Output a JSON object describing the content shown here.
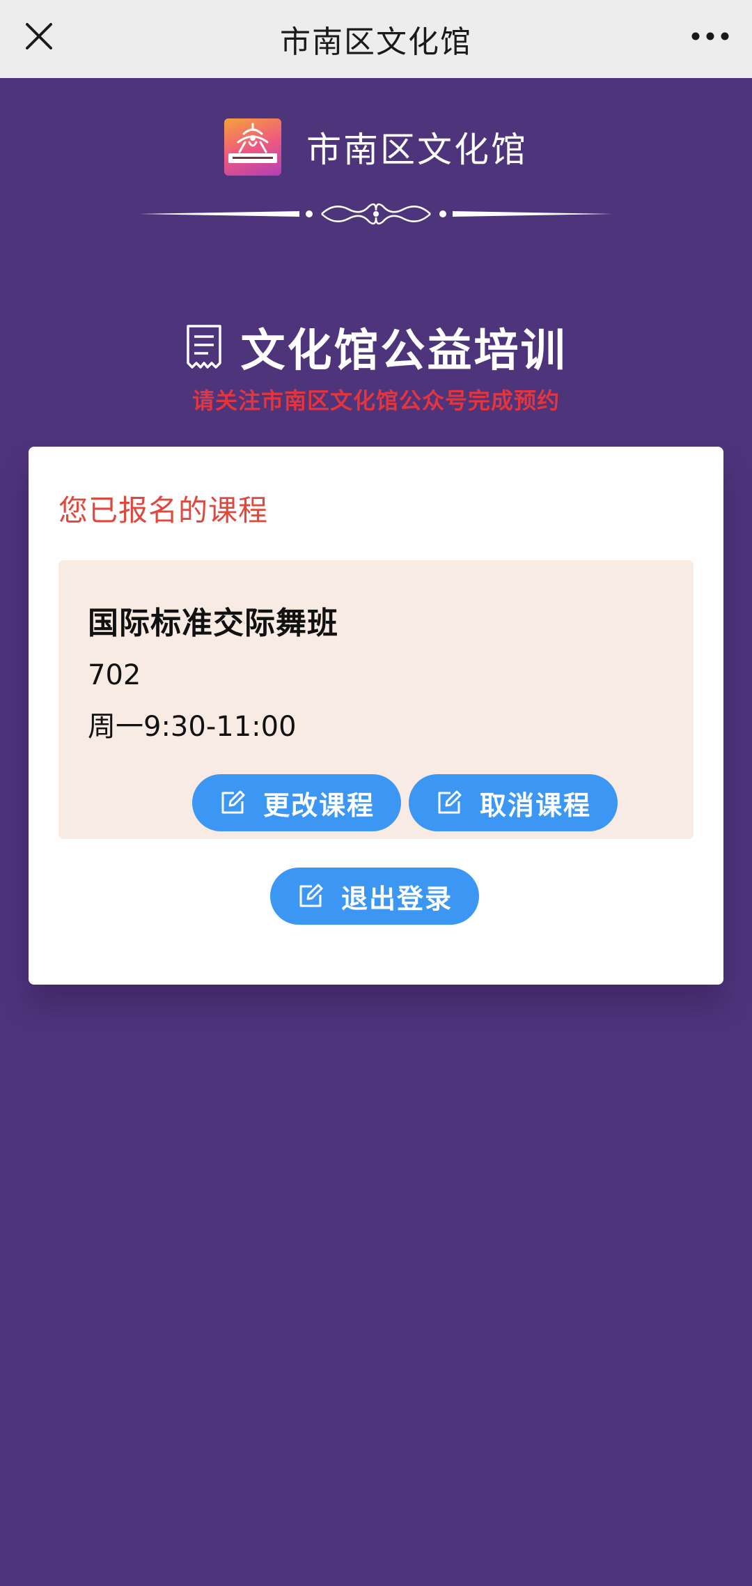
{
  "topbar": {
    "title": "市南区文化馆",
    "close_icon": "close-icon",
    "more_icon": "more-horizontal-icon"
  },
  "brand": {
    "name": "市南区文化馆",
    "logo_icon": "culture-center-logo"
  },
  "section": {
    "icon": "receipt-icon",
    "title": "文化馆公益培训",
    "subtitle": "请关注市南区文化馆公众号完成预约"
  },
  "card": {
    "heading": "您已报名的课程",
    "course": {
      "name": "国际标准交际舞班",
      "room": "702",
      "time": "周一9:30-11:00"
    },
    "buttons": {
      "change": "更改课程",
      "cancel": "取消课程",
      "logout": "退出登录",
      "icon": "edit-icon"
    }
  },
  "colors": {
    "background": "#4e347b",
    "topbar": "#ededed",
    "accent_blue": "#3b97f3",
    "alert_red": "#e2353d",
    "course_box": "#f7ebe4"
  }
}
